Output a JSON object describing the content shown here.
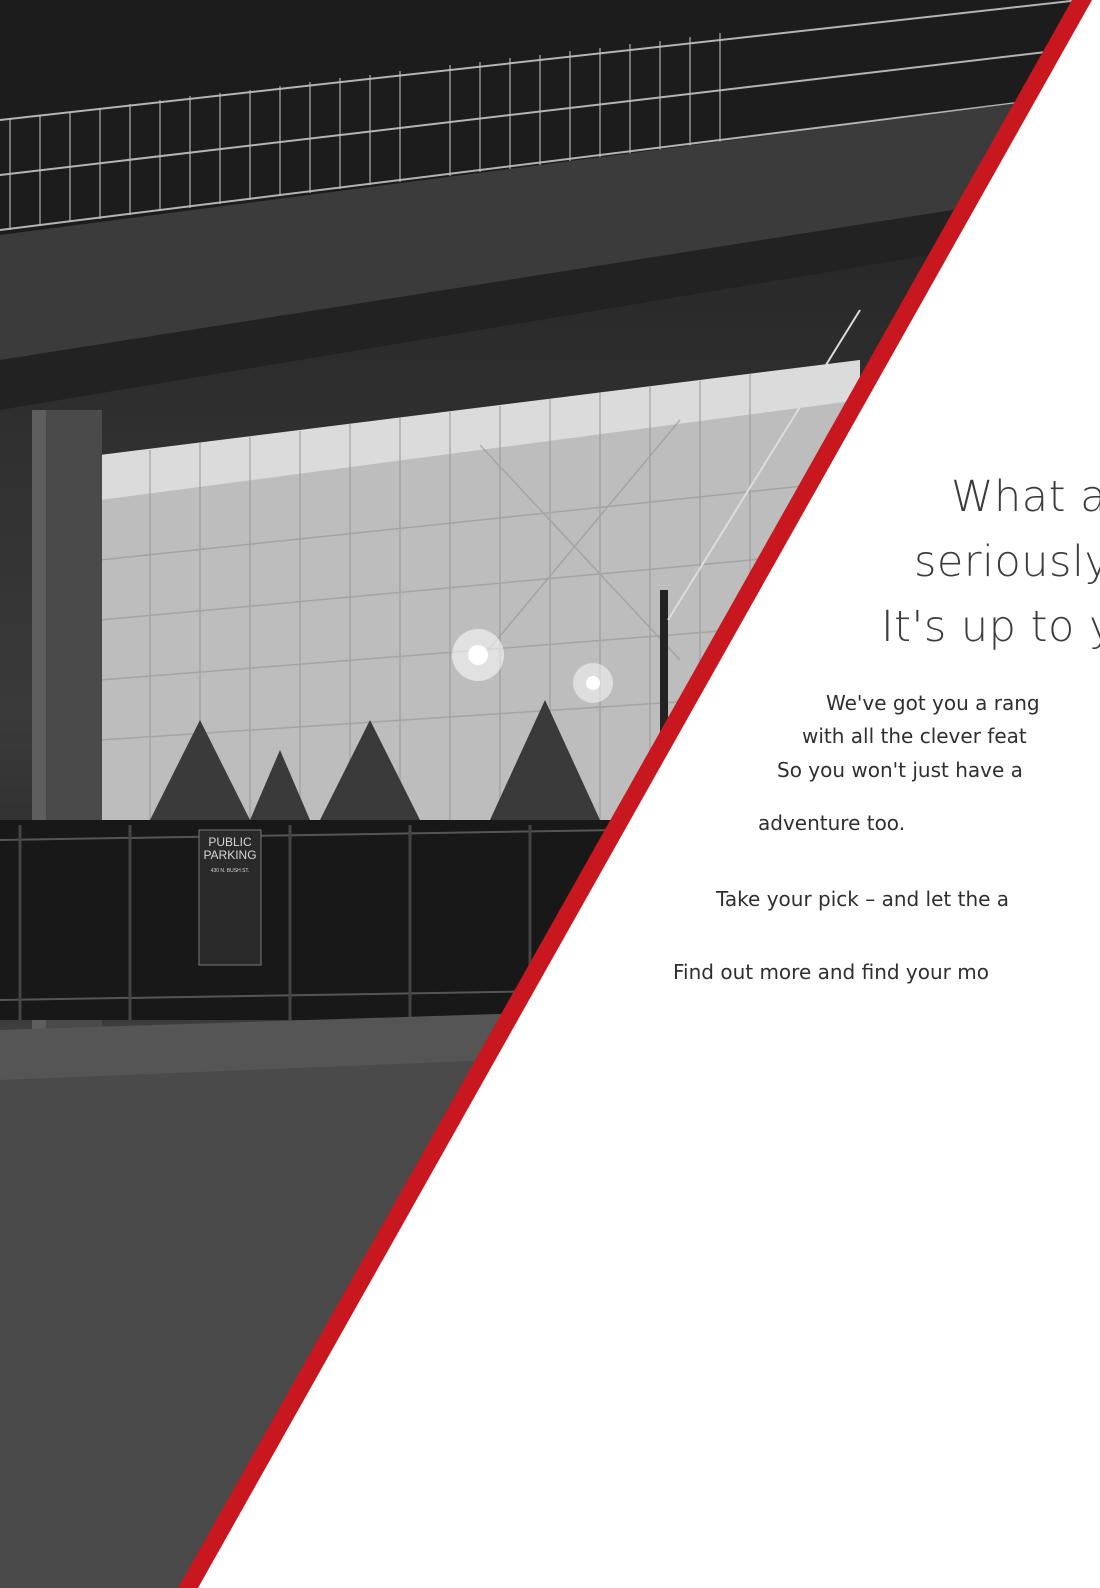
{
  "headline": {
    "line1": "What a",
    "line2": "seriously",
    "line3": "It's up to y"
  },
  "body": {
    "p1_line1": "We've got you a rang",
    "p1_line2": "with all the clever feat",
    "p1_line3": "So you won't just have a",
    "p1_line4": "adventure too.",
    "p2_line1": "Take your pick – and let the a",
    "p3_line1": "Find out more and find your mo"
  },
  "colors": {
    "accent_red": "#c8171e",
    "text": "#333333"
  },
  "photo": {
    "parking_sign_line1": "PUBLIC",
    "parking_sign_line2": "PARKING",
    "parking_sign_line3": "430 N. BUSH ST."
  }
}
